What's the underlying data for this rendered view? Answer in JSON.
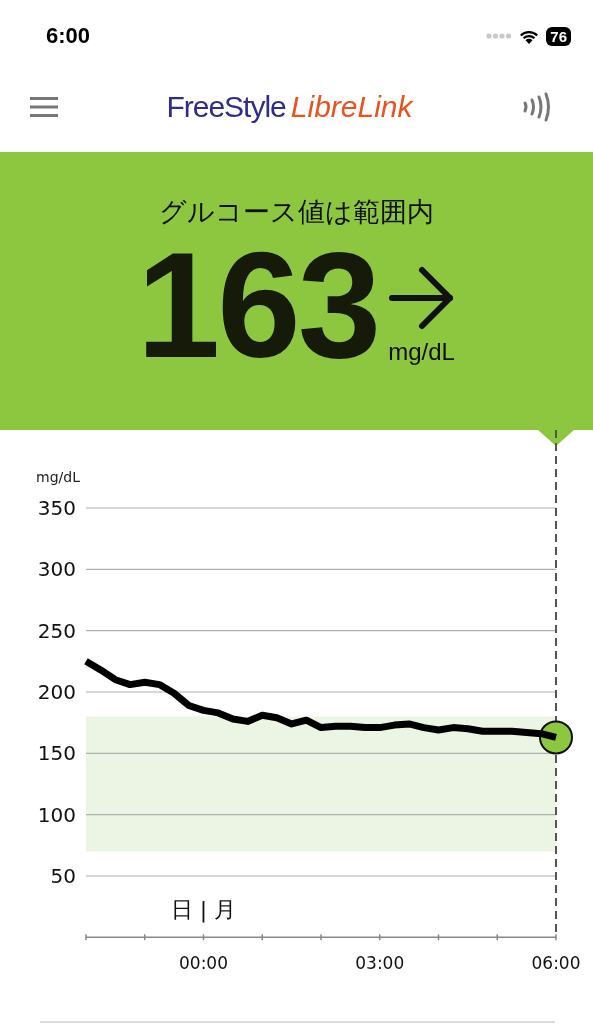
{
  "status_bar": {
    "time": "6:00",
    "battery": "76"
  },
  "header": {
    "logo_first": "FreeStyle",
    "logo_second": "LibreLink"
  },
  "reading": {
    "message": "グルコース値は範囲内",
    "value": "163",
    "unit": "mg/dL"
  },
  "chart": {
    "day_label": "日 | 月",
    "chart_data": {
      "type": "line",
      "ylabel": "mg/dL",
      "x": [
        -2,
        -1.75,
        -1.5,
        -1.25,
        -1,
        -0.75,
        -0.5,
        -0.25,
        0,
        0.25,
        0.5,
        0.75,
        1,
        1.25,
        1.5,
        1.75,
        2,
        2.25,
        2.5,
        2.75,
        3,
        3.25,
        3.5,
        3.75,
        4,
        4.25,
        4.5,
        4.75,
        5,
        5.25,
        5.5,
        5.75,
        6
      ],
      "values": [
        225,
        218,
        210,
        206,
        208,
        206,
        199,
        189,
        185,
        183,
        178,
        176,
        181,
        179,
        174,
        177,
        171,
        172,
        172,
        171,
        171,
        173,
        174,
        171,
        169,
        171,
        170,
        168,
        168,
        168,
        167,
        166,
        163
      ],
      "xlim": [
        -2,
        6
      ],
      "ylim": [
        0,
        350
      ],
      "xticks": [
        {
          "value": 0,
          "label": "00:00"
        },
        {
          "value": 3,
          "label": "03:00"
        },
        {
          "value": 6,
          "label": "06:00"
        }
      ],
      "yticks": [
        50,
        100,
        150,
        200,
        250,
        300,
        350
      ],
      "grid": true,
      "bands": [
        {
          "axis": "y",
          "from": 70,
          "to": 180
        }
      ]
    }
  }
}
